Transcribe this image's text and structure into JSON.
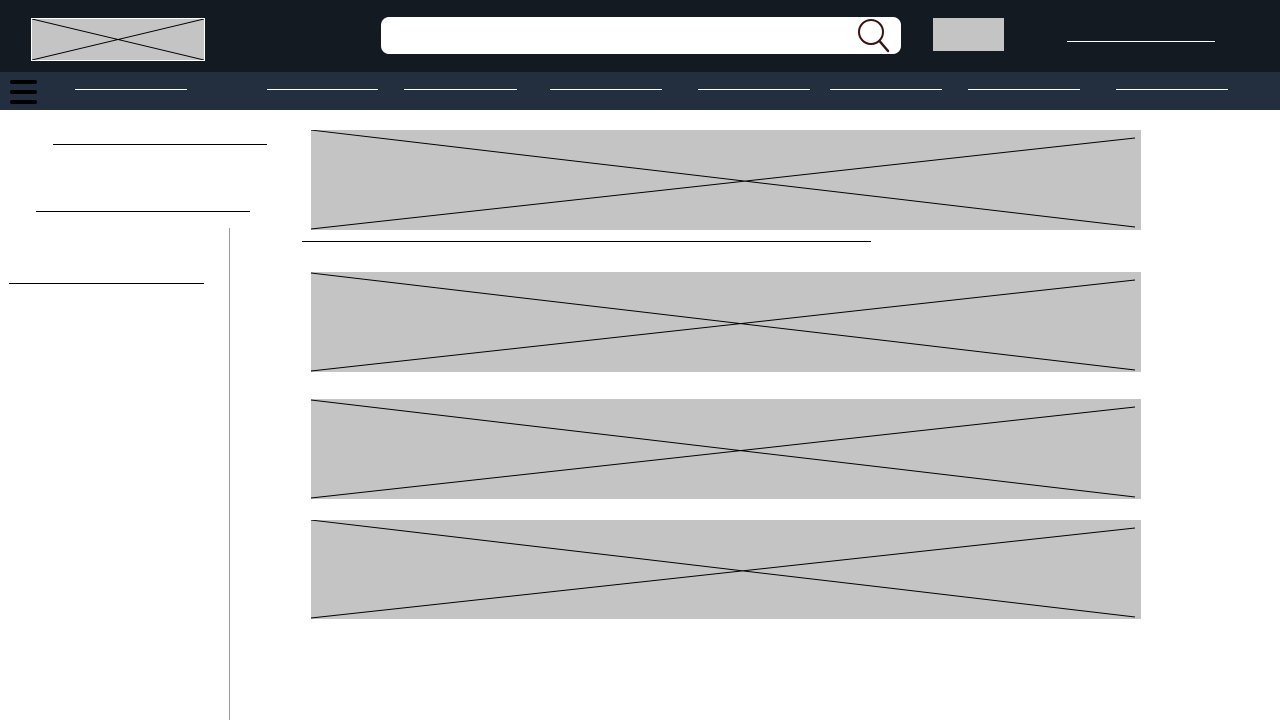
{
  "header": {
    "logo_icon": "placeholder-image-icon",
    "search": {
      "placeholder": "",
      "value": "",
      "icon": "search-icon",
      "icon_color": "#3a1414"
    },
    "button_label": "",
    "link_label": ""
  },
  "nav": {
    "menu_icon": "hamburger-menu-icon",
    "items": [
      {
        "label": ""
      },
      {
        "label": ""
      },
      {
        "label": ""
      },
      {
        "label": ""
      },
      {
        "label": ""
      },
      {
        "label": ""
      },
      {
        "label": ""
      },
      {
        "label": ""
      }
    ]
  },
  "sidebar": {
    "links": [
      {
        "label": ""
      },
      {
        "label": ""
      },
      {
        "label": ""
      }
    ]
  },
  "main": {
    "banners": [
      {
        "icon": "placeholder-image-icon"
      },
      {
        "icon": "placeholder-image-icon"
      },
      {
        "icon": "placeholder-image-icon"
      },
      {
        "icon": "placeholder-image-icon"
      }
    ],
    "link_label": ""
  },
  "colors": {
    "header_bg": "#131a22",
    "nav_bg": "#232f3e",
    "placeholder_fill": "#c4c4c4",
    "page_bg": "#ffffff"
  }
}
